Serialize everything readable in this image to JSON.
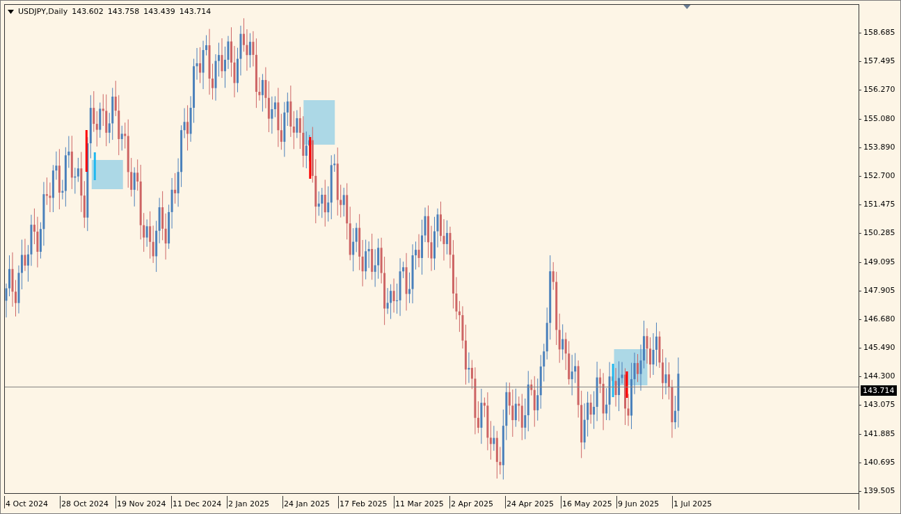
{
  "header": {
    "symbol": "USDJPY,Daily",
    "ohlc": [
      "143.602",
      "143.758",
      "143.439",
      "143.714"
    ]
  },
  "price_axis": {
    "ticks": [
      "158.685",
      "157.495",
      "156.270",
      "155.080",
      "153.890",
      "152.700",
      "151.475",
      "150.285",
      "149.095",
      "147.905",
      "146.680",
      "145.490",
      "144.300",
      "143.075",
      "141.885",
      "140.695",
      "139.505"
    ],
    "current": "143.714"
  },
  "date_axis": {
    "labels": [
      "4 Oct 2024",
      "28 Oct 2024",
      "19 Nov 2024",
      "11 Dec 2024",
      "2 Jan 2025",
      "24 Jan 2025",
      "17 Feb 2025",
      "11 Mar 2025",
      "2 Apr 2025",
      "24 Apr 2025",
      "16 May 2025",
      "9 Jun 2025",
      "1 Jul 2025"
    ]
  }
}
